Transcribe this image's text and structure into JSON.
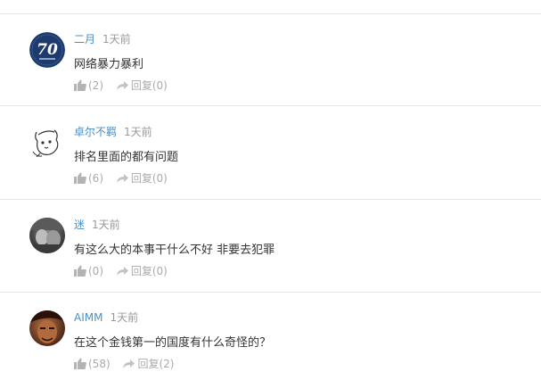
{
  "comments": [
    {
      "username": "二月",
      "time": "1天前",
      "text": "网络暴力暴利",
      "likes": "(2)",
      "reply": "回复(0)",
      "avatar_icon": "badge-70-avatar",
      "avatar_text": "70"
    },
    {
      "username": "卓尔不羁",
      "time": "1天前",
      "text": "排名里面的都有问题",
      "likes": "(6)",
      "reply": "回复(0)",
      "avatar_icon": "cartoon-dog-avatar"
    },
    {
      "username": "迷",
      "time": "1天前",
      "text": "有这么大的本事干什么不好 非要去犯罪",
      "likes": "(0)",
      "reply": "回复(0)",
      "avatar_icon": "photo-avatar"
    },
    {
      "username": "AIMM",
      "time": "1天前",
      "text": "在这个金钱第一的国度有什么奇怪的？",
      "likes": "(58)",
      "reply": "回复(2)",
      "avatar_icon": "warrior-avatar"
    }
  ],
  "colors": {
    "username": "#4a90c8",
    "meta": "#999999",
    "text": "#333333",
    "action": "#aaaaaa",
    "divider": "#e6e6e6"
  }
}
